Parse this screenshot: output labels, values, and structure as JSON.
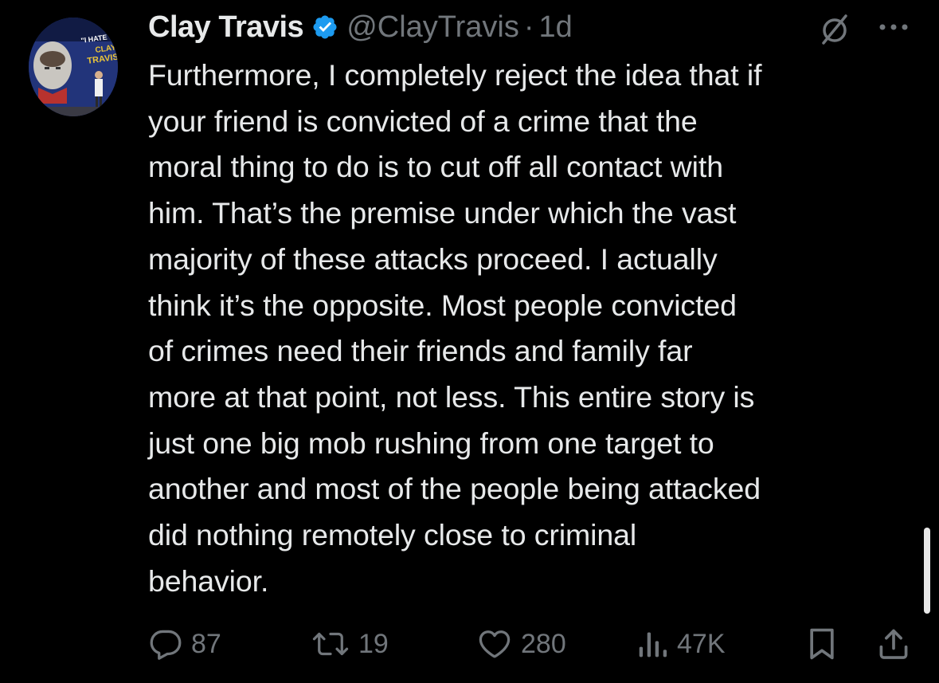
{
  "tweet": {
    "author": {
      "display_name": "Clay Travis",
      "handle": "@ClayTravis",
      "verified": true,
      "avatar_sign_lines": [
        "\"I HATE YOU",
        "CLAY",
        "TRAVIS\""
      ]
    },
    "separator": "·",
    "time": "1d",
    "text_lines": [
      "Furthermore, I completely reject the idea that if",
      "your friend is convicted of a crime that the",
      "moral thing to do is to cut off all contact with",
      "him. That’s the premise under which the vast",
      "majority of these attacks proceed. I actually",
      "think it’s the opposite. Most people convicted",
      "of crimes need their friends and family far",
      "more at that point, not less. This entire story is",
      "just one big mob rushing from one target to",
      "another and most of the people being attacked",
      "did nothing remotely close to criminal",
      "behavior."
    ],
    "actions": {
      "replies": "87",
      "reposts": "19",
      "likes": "280",
      "views": "47K"
    }
  },
  "colors": {
    "background": "#000000",
    "text": "#e7e9ea",
    "secondary": "#71767b",
    "verified_badge": "#1d9bf0"
  },
  "icons": {
    "header": [
      "verified-badge-icon",
      "grok-icon",
      "more-icon"
    ],
    "actions": [
      "reply-icon",
      "repost-icon",
      "like-icon",
      "views-icon",
      "bookmark-icon",
      "share-icon"
    ]
  }
}
